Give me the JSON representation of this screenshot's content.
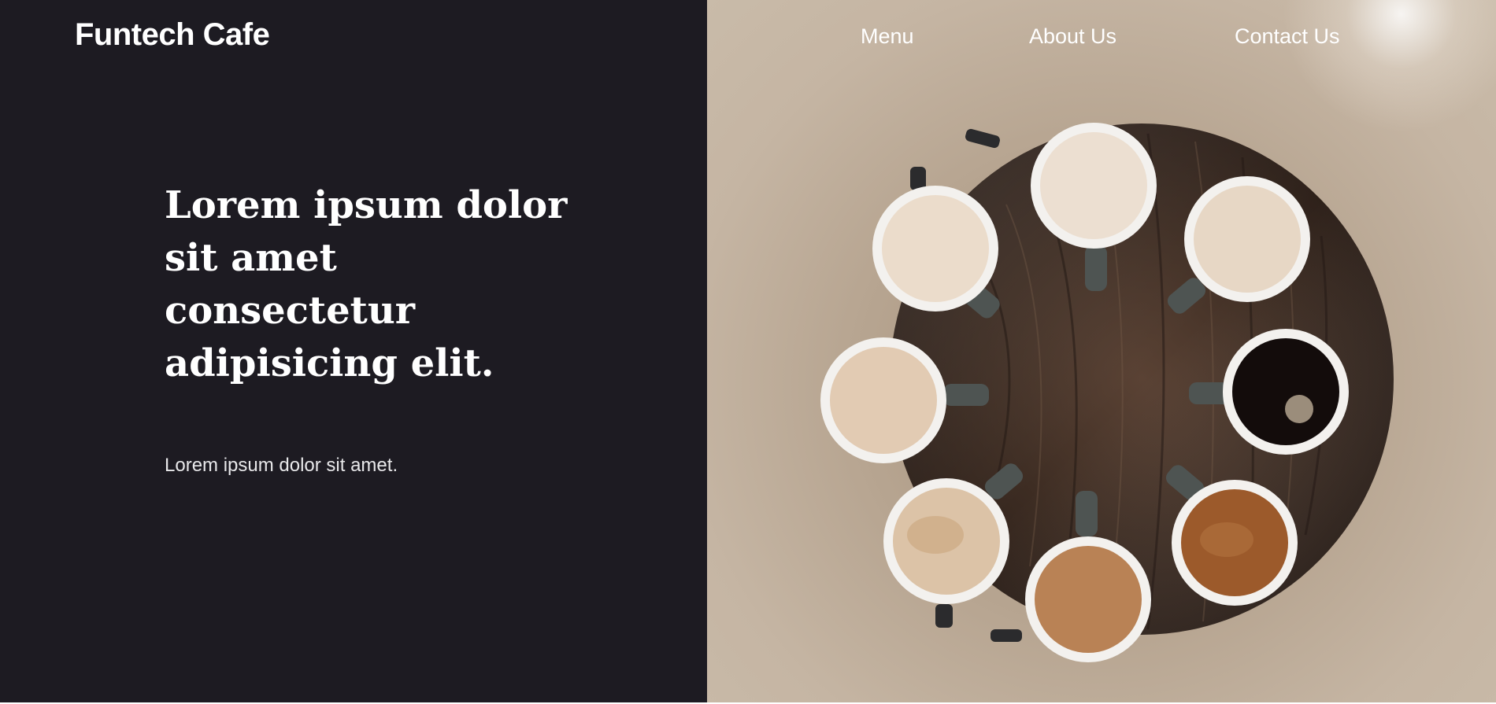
{
  "brand": {
    "name": "Funtech Cafe"
  },
  "nav": {
    "items": [
      {
        "label": "Menu"
      },
      {
        "label": "About Us"
      },
      {
        "label": "Contact Us"
      }
    ]
  },
  "hero": {
    "title": "Lorem ipsum dolor sit amet consectetur adipisicing elit.",
    "subtitle": "Lorem ipsum dolor sit amet."
  },
  "colors": {
    "left_panel_bg": "#1d1b22",
    "text_primary": "#ffffff",
    "table_wood": "#3b2c23",
    "cup_rim": "#f3f1ee",
    "cup_handle": "#4e5452"
  },
  "hero_image": {
    "subject": "coffee-cups-on-round-table",
    "drinks": [
      {
        "color": "#ebdccb"
      },
      {
        "color": "#ecdfd1"
      },
      {
        "color": "#e2cbb3"
      },
      {
        "color": "#130c0b"
      },
      {
        "color": "#dcc3a7"
      },
      {
        "color": "#d8ad7c"
      },
      {
        "color": "#b98255"
      },
      {
        "color": "#9c5a2b"
      }
    ]
  }
}
